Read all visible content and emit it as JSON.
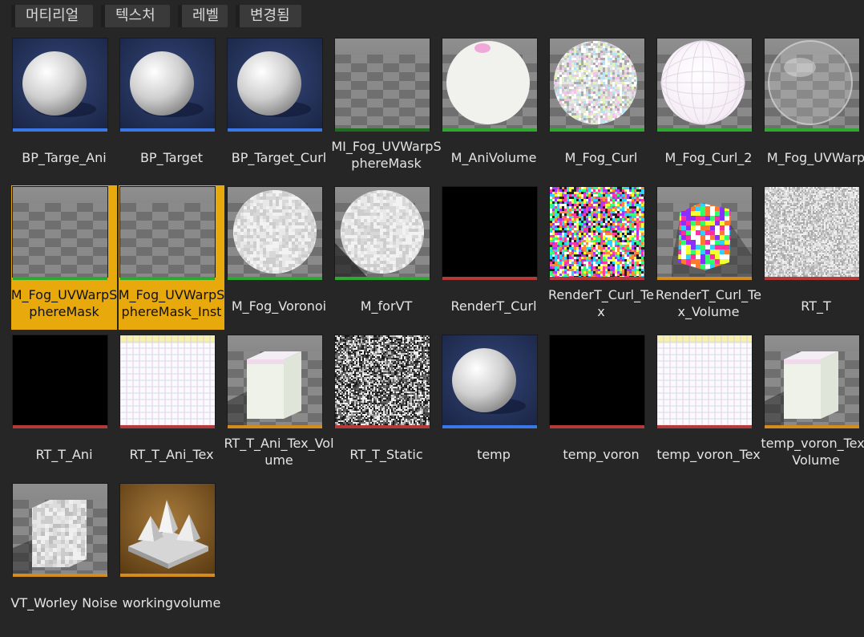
{
  "filters": [
    "머티리얼",
    "텍스처",
    "레벨",
    "변경됨"
  ],
  "colors": {
    "bar_blue": "#3b78e7",
    "bar_green": "#2fa82f",
    "bar_darkgreen": "#1f6e1f",
    "bar_red": "#b23a3a",
    "bar_orange": "#d58c1f",
    "selection": "#e8a90d"
  },
  "assets": [
    {
      "label": "BP_Targe_Ani",
      "thumb": "sphere",
      "bar": "blue",
      "selected": false
    },
    {
      "label": "BP_Target",
      "thumb": "sphere",
      "bar": "blue",
      "selected": false
    },
    {
      "label": "BP_Target_Curl",
      "thumb": "sphere",
      "bar": "blue",
      "selected": false
    },
    {
      "label": "MI_Fog_UVWarpSphereMask",
      "thumb": "checker",
      "bar": "darkgreen",
      "selected": false
    },
    {
      "label": "M_AniVolume",
      "thumb": "white-sphere",
      "bar": "green",
      "selected": false
    },
    {
      "label": "M_Fog_Curl",
      "thumb": "noise-sphere",
      "bar": "green",
      "selected": false
    },
    {
      "label": "M_Fog_Curl_2",
      "thumb": "grid-sphere",
      "bar": "green",
      "selected": false
    },
    {
      "label": "M_Fog_UVWarp",
      "thumb": "glass-sphere",
      "bar": "green",
      "selected": false
    },
    {
      "label": "M_Fog_UVWarpSphereMask",
      "thumb": "checker",
      "bar": "green",
      "selected": true
    },
    {
      "label": "M_Fog_UVWarpSphereMask_Inst",
      "thumb": "checker",
      "bar": "green",
      "selected": true
    },
    {
      "label": "M_Fog_Voronoi",
      "thumb": "gray-sphere",
      "bar": "green",
      "selected": false
    },
    {
      "label": "M_forVT",
      "thumb": "gray-sphere-shadow",
      "bar": "green",
      "selected": false
    },
    {
      "label": "RenderT_Curl",
      "thumb": "black",
      "bar": "red",
      "selected": false
    },
    {
      "label": "RenderT_Curl_Tex",
      "thumb": "color-noise",
      "bar": "red",
      "selected": false
    },
    {
      "label": "RenderT_Curl_Tex_Volume",
      "thumb": "color-cube",
      "bar": "orange",
      "selected": false
    },
    {
      "label": "RT_T",
      "thumb": "gray-noise",
      "bar": "red",
      "selected": false
    },
    {
      "label": "RT_T_Ani",
      "thumb": "black",
      "bar": "red",
      "selected": false
    },
    {
      "label": "RT_T_Ani_Tex",
      "thumb": "grid-flat",
      "bar": "red",
      "selected": false
    },
    {
      "label": "RT_T_Ani_Tex_Volume",
      "thumb": "white-cube",
      "bar": "orange",
      "selected": false
    },
    {
      "label": "RT_T_Static",
      "thumb": "static-noise",
      "bar": "red",
      "selected": false
    },
    {
      "label": "temp",
      "thumb": "sphere",
      "bar": "blue",
      "selected": false
    },
    {
      "label": "temp_voron",
      "thumb": "black",
      "bar": "red",
      "selected": false
    },
    {
      "label": "temp_voron_Tex",
      "thumb": "grid-flat",
      "bar": "red",
      "selected": false
    },
    {
      "label": "temp_voron_Tex_Volume",
      "thumb": "white-cube",
      "bar": "orange",
      "selected": false
    },
    {
      "label": "VT_Worley Noise",
      "thumb": "worley-cube",
      "bar": "orange",
      "selected": false
    },
    {
      "label": "workingvolume",
      "thumb": "level",
      "bar": "orange",
      "selected": false
    }
  ]
}
